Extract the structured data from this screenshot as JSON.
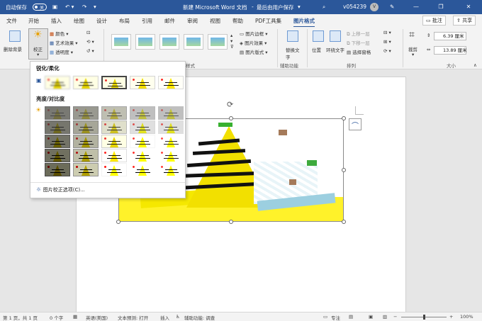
{
  "titlebar": {
    "autosave_label": "自动保存",
    "autosave_state": "关",
    "doc_title": "新建 Microsoft Word 文档",
    "save_state": "最后由用户保存",
    "user_name": "v054239",
    "avatar_initial": "V"
  },
  "tabs": [
    {
      "label": "文件"
    },
    {
      "label": "开始"
    },
    {
      "label": "插入"
    },
    {
      "label": "绘图"
    },
    {
      "label": "设计"
    },
    {
      "label": "布局"
    },
    {
      "label": "引用"
    },
    {
      "label": "邮件"
    },
    {
      "label": "审阅"
    },
    {
      "label": "视图"
    },
    {
      "label": "帮助"
    },
    {
      "label": "PDF工具集"
    },
    {
      "label": "图片格式"
    }
  ],
  "ribbon_right": {
    "comment": "批注",
    "share": "共享"
  },
  "ribbon": {
    "remove_bg": "删除背景",
    "corrections": "校正",
    "color": "颜色",
    "artistic": "艺术效果",
    "transparency": "透明度",
    "border": "图片边框",
    "effects": "图片效果",
    "layout": "图片版式",
    "styles_group": "样式",
    "alt_text": "替换文字",
    "accessibility_group": "辅助功能",
    "position": "位置",
    "wrap": "环绕文字",
    "bring_forward": "上移一层",
    "send_backward": "下移一层",
    "selection_pane": "选择窗格",
    "arrange_group": "排列",
    "crop": "裁剪",
    "height": "6.39 厘米",
    "width": "13.89 厘米",
    "size_group": "大小"
  },
  "dropdown": {
    "sharpen_title": "锐化/柔化",
    "brightness_title": "亮度/对比度",
    "options_link": "图片校正选项(C)..."
  },
  "status": {
    "page": "第 1 页，共 1 页",
    "words": "0 个字",
    "lang": "英语(美国)",
    "predict": "文本预测: 打开",
    "insert": "插入",
    "access": "辅助功能: 调查",
    "focus": "专注",
    "zoom": "100%"
  }
}
